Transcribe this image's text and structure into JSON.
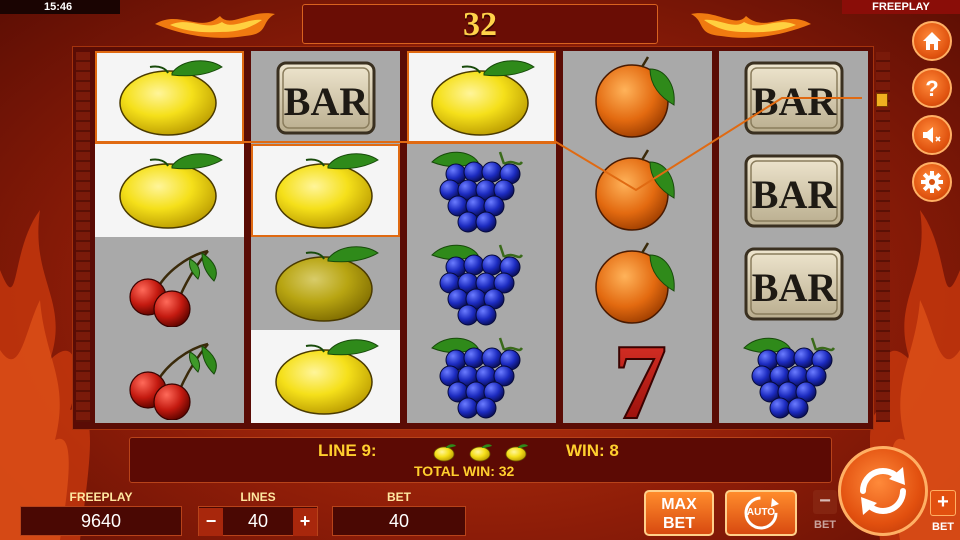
{
  "status_bar": {
    "time": "15:46",
    "mode": "FREEPLAY"
  },
  "header": {
    "total_display": "32"
  },
  "reels": [
    [
      "lemon",
      "lemon",
      "cherries",
      "cherries"
    ],
    [
      "bar",
      "lemon",
      "lemon",
      "lemon"
    ],
    [
      "lemon",
      "grapes",
      "grapes",
      "grapes"
    ],
    [
      "orange",
      "orange",
      "orange",
      "seven"
    ],
    [
      "bar",
      "bar",
      "bar",
      "grapes"
    ]
  ],
  "symbols": {
    "bar_text": "BAR",
    "seven_text": "7"
  },
  "win_info": {
    "line_label": "LINE 9:",
    "line_symbols": [
      "lemon",
      "lemon",
      "lemon"
    ],
    "win_label": "WIN: 8",
    "total_win_label": "TOTAL WIN: 32"
  },
  "controls": {
    "freeplay_label": "FREEPLAY",
    "freeplay_value": "9640",
    "lines_label": "LINES",
    "lines_value": "40",
    "lines_minus": "−",
    "lines_plus": "+",
    "bet_label": "BET",
    "bet_value": "40",
    "max_bet_line1": "MAX",
    "max_bet_line2": "BET",
    "auto_label": "AUTO",
    "bet_minus": "−",
    "bet_plus": "+",
    "bet_minus_label": "BET",
    "bet_plus_label": "BET"
  },
  "side_menu": [
    "home-icon",
    "help-icon",
    "sound-off-icon",
    "settings-icon"
  ],
  "colors": {
    "accent": "#ffcf2e",
    "frame": "#5a0c05",
    "button": "#e2500f"
  }
}
